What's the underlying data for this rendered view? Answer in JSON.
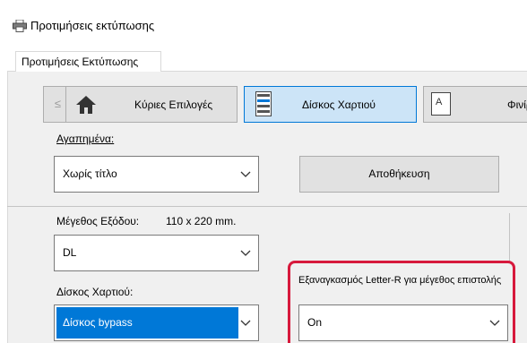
{
  "window": {
    "title": "Προτιμήσεις εκτύπωσης"
  },
  "tabs": [
    {
      "label": "Προτιμήσεις Εκτύπωσης"
    }
  ],
  "nav": {
    "back_label": "≤",
    "buttons": [
      {
        "label": "Κύριες Επιλογές",
        "icon": "home-icon"
      },
      {
        "label": "Δίσκος Χαρτιού",
        "icon": "paper-tray-icon",
        "active": true
      },
      {
        "label": "Φινίρ",
        "icon": "finishing-icon"
      }
    ]
  },
  "favorites": {
    "label": "Αγαπημένα:",
    "value": "Χωρίς τίτλο",
    "save_label": "Αποθήκευση"
  },
  "output_size": {
    "label": "Μέγεθος Εξόδου:",
    "dimension": "110 x 220 mm.",
    "value": "DL"
  },
  "paper_tray": {
    "label": "Δίσκος Χαρτιού:",
    "value": "Δίσκος bypass"
  },
  "letter_r": {
    "label": "Εξαναγκασμός Letter-R για μέγεθος επιστολής",
    "value": "On"
  },
  "colors": {
    "accent": "#0078d7",
    "highlight_frame": "#d7193c",
    "active_tab_bg": "#cce4f7"
  }
}
